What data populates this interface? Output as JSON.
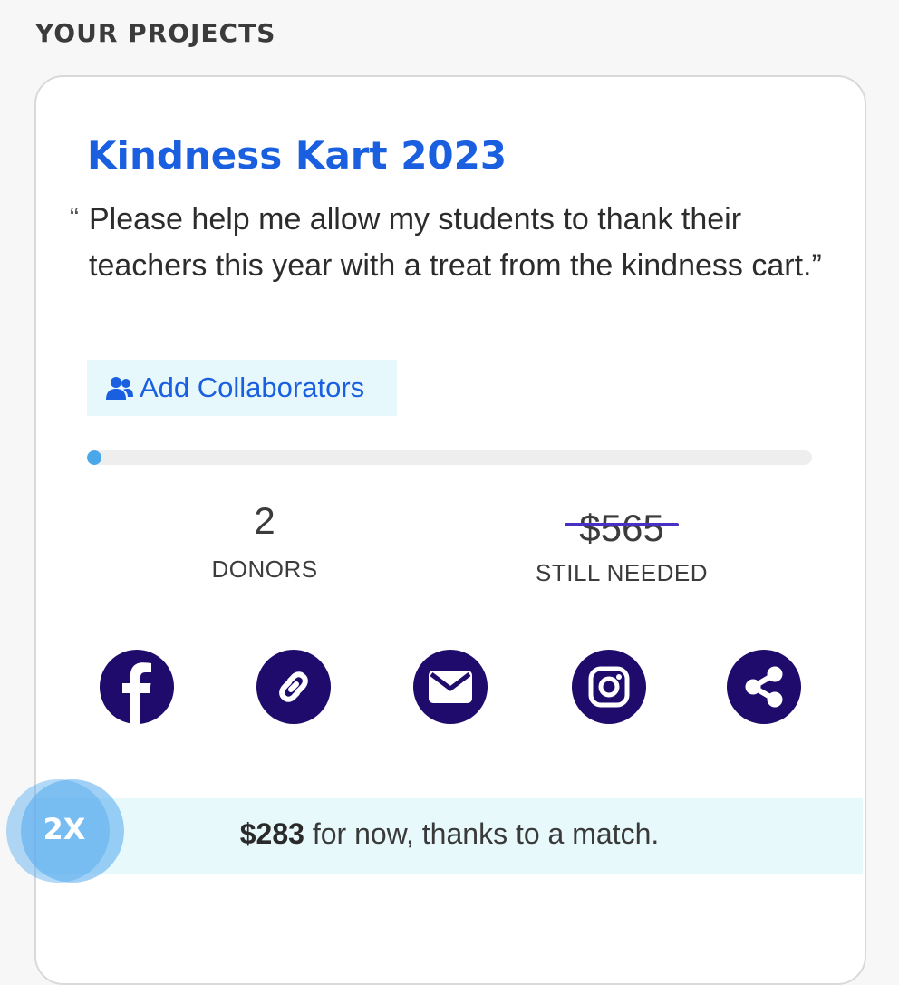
{
  "section": {
    "title": "YOUR PROJECTS"
  },
  "project": {
    "title": "Kindness Kart 2023",
    "quote": "Please help me allow my students to thank their teachers this year with a treat from the kindness cart.”",
    "quote_open": "“",
    "collab_label": "Add Collaborators",
    "progress_percent": 1,
    "colors": {
      "accent": "#1a5fe0",
      "share": "#1e0b6b",
      "progress": "#4aa7ea",
      "strike": "#4a2fc4"
    }
  },
  "stats": {
    "donors_value": "2",
    "donors_label": "DONORS",
    "needed_value": "$565",
    "needed_label": "STILL NEEDED"
  },
  "share": {
    "buttons": [
      "facebook-icon",
      "link-icon",
      "email-icon",
      "instagram-icon",
      "share-icon"
    ]
  },
  "match": {
    "badge": "2X",
    "amount": "$283",
    "text": " for now, thanks to a match."
  }
}
